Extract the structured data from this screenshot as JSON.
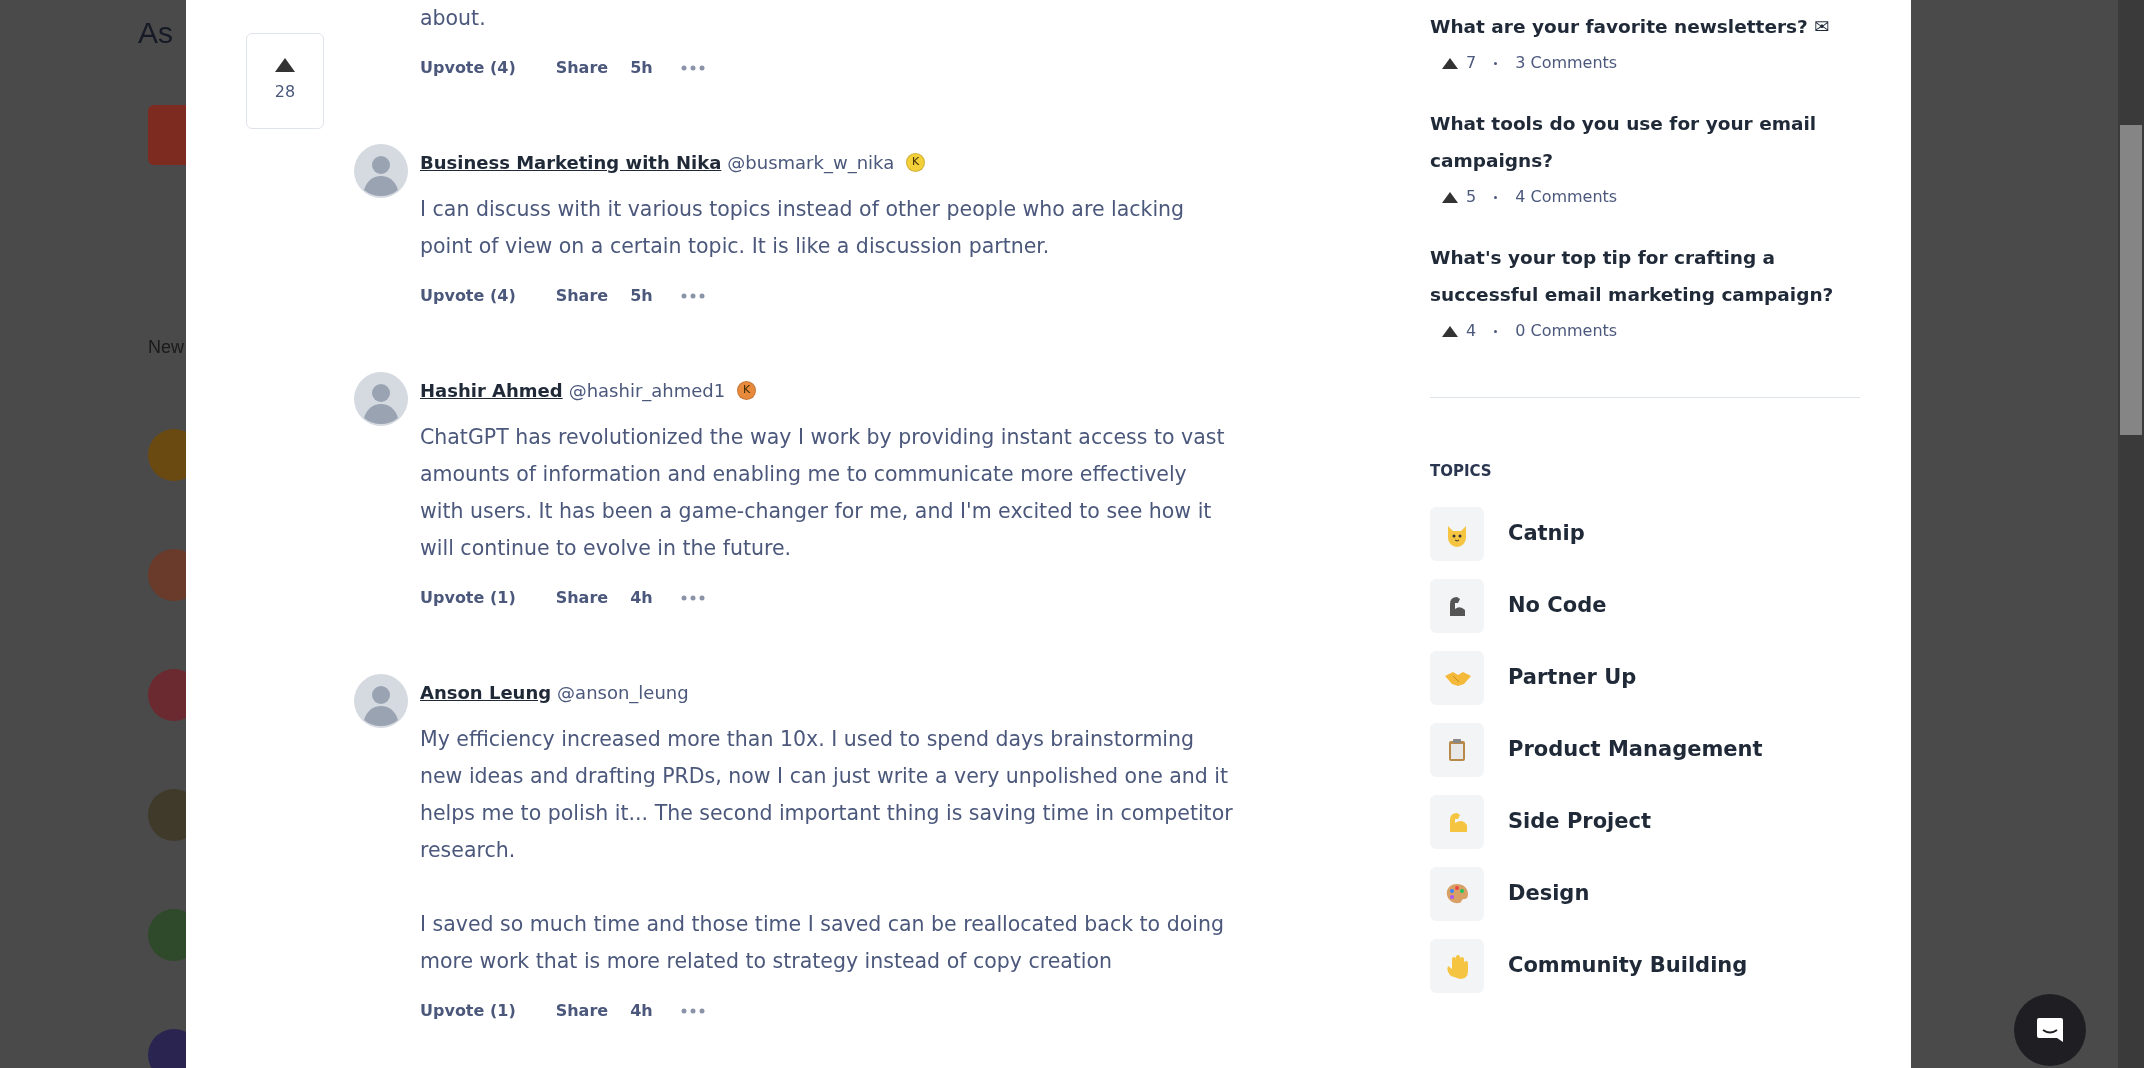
{
  "background_page": {
    "heading": "As",
    "section_label": "New"
  },
  "post_votes": {
    "count": "28"
  },
  "comments": [
    {
      "body": [
        "about."
      ],
      "upvote": "Upvote (4)",
      "share": "Share",
      "time": "5h"
    },
    {
      "author": "Business Marketing with Nika",
      "handle": "@busmark_w_nika",
      "badge": {
        "label": "K",
        "color": "#f3cf3a"
      },
      "body": [
        "I can discuss with it various topics instead of other people who are lacking point of view on a certain topic. It is like a discussion partner."
      ],
      "upvote": "Upvote (4)",
      "share": "Share",
      "time": "5h"
    },
    {
      "author": "Hashir Ahmed",
      "handle": "@hashir_ahmed1",
      "badge": {
        "label": "K",
        "color": "#e88a3c"
      },
      "body": [
        "ChatGPT has revolutionized the way I work by providing instant access to vast amounts of information and enabling me to communicate more effectively with users. It has been a game-changer for me, and I'm excited to see how it will continue to evolve in the future."
      ],
      "upvote": "Upvote (1)",
      "share": "Share",
      "time": "4h"
    },
    {
      "author": "Anson Leung",
      "handle": "@anson_leung",
      "body": [
        "My efficiency increased more than 10x. I used to spend days brainstorming new ideas and drafting PRDs, now I can just write a very unpolished one and it helps me to polish it... The second important thing is saving time in competitor research.",
        "I saved so much time and those time I saved can be reallocated back to doing more work that is more related to strategy instead of copy creation"
      ],
      "upvote": "Upvote (1)",
      "share": "Share",
      "time": "4h"
    }
  ],
  "discussions": [
    {
      "title": "What are your favorite newsletters? ✉",
      "votes": "7",
      "comments": "3 Comments"
    },
    {
      "title": "What tools do you use for your email campaigns?",
      "votes": "5",
      "comments": "4 Comments"
    },
    {
      "title": "What's your top tip for crafting a successful email marketing campaign?",
      "votes": "4",
      "comments": "0 Comments"
    }
  ],
  "topics_heading": "TOPICS",
  "topics": [
    {
      "label": "Catnip"
    },
    {
      "label": "No Code"
    },
    {
      "label": "Partner Up"
    },
    {
      "label": "Product Management"
    },
    {
      "label": "Side Project"
    },
    {
      "label": "Design"
    },
    {
      "label": "Community Building"
    }
  ]
}
